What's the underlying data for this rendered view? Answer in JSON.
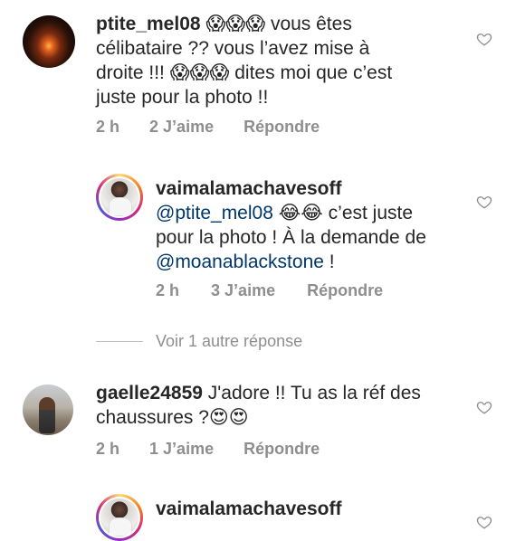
{
  "comments": [
    {
      "username": "ptite_mel08",
      "text_1": "vous êtes",
      "text_2": "célibataire ?? vous l’avez mise à",
      "text_3": "droite !!!",
      "text_4": "dites moi que c’est",
      "text_5": "juste pour la photo !!",
      "emoji_a": "😱😱😱",
      "emoji_b": "😱😱😱",
      "time": "2 h",
      "likes": "2 J’aime",
      "reply": "Répondre"
    },
    {
      "username": "vaimalamachavesoff",
      "mention_1": "@ptite_mel08",
      "emoji": "😂😂",
      "text_1": "c’est juste",
      "text_2": "pour la photo ! À la demande de",
      "mention_2": "@moanablackstone",
      "text_3": "!",
      "time": "2 h",
      "likes": "3 J’aime",
      "reply": "Répondre"
    },
    {
      "username": "gaelle24859",
      "text_1": "J'adore !! Tu as la réf des",
      "text_2": "chaussures ?",
      "emoji": "😍😍",
      "time": "2 h",
      "likes": "1 J’aime",
      "reply": "Répondre"
    },
    {
      "username": "vaimalamachavesoff"
    }
  ],
  "view_more": "Voir 1 autre réponse",
  "icons": {
    "heart": "heart-outline-icon"
  },
  "colors": {
    "text": "#262626",
    "meta": "#8e8e8e",
    "mention": "#00376b"
  }
}
